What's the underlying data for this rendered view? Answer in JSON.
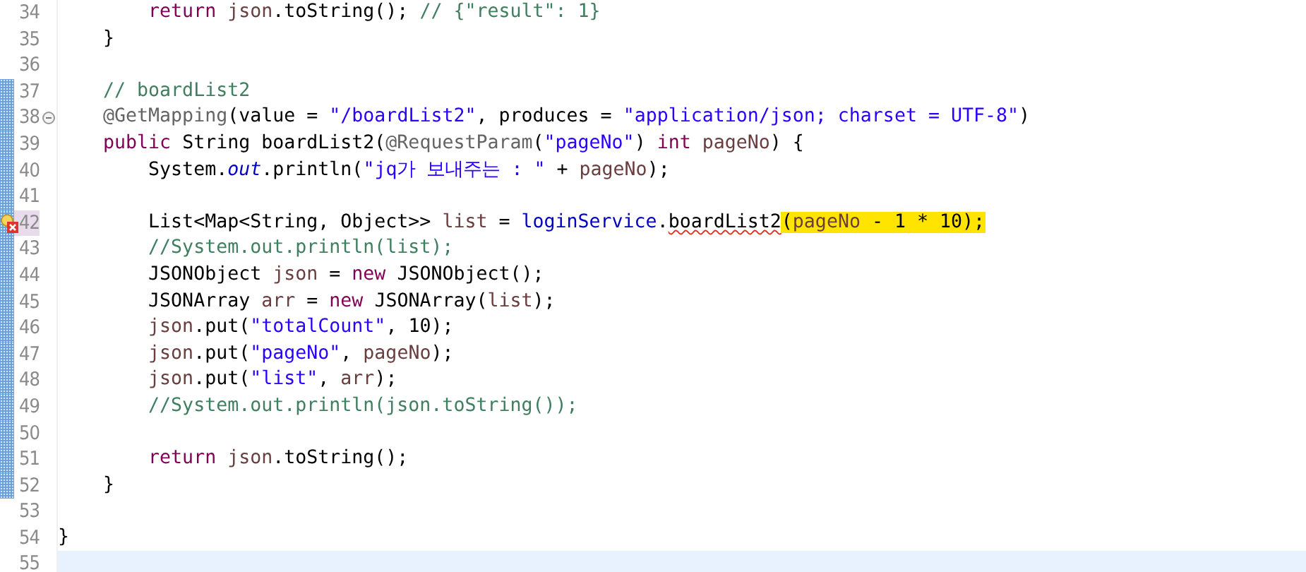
{
  "editor": {
    "lines": [
      {
        "number": "34",
        "changed": false,
        "fold": false,
        "error": false,
        "current": false,
        "tokens": [
          {
            "kind": "keyword",
            "text": "        return "
          },
          {
            "kind": "local",
            "text": "json"
          },
          {
            "kind": "plain",
            "text": ".toString(); "
          },
          {
            "kind": "comment",
            "text": "// {\"result\": 1}"
          }
        ]
      },
      {
        "number": "35",
        "changed": false,
        "fold": false,
        "error": false,
        "current": false,
        "tokens": [
          {
            "kind": "plain",
            "text": "    }"
          }
        ]
      },
      {
        "number": "36",
        "changed": false,
        "fold": false,
        "error": false,
        "current": false
      },
      {
        "number": "37",
        "changed": true,
        "fold": false,
        "error": false,
        "current": false,
        "tokens": [
          {
            "kind": "comment",
            "text": "    // boardList2"
          }
        ]
      },
      {
        "number": "38",
        "changed": true,
        "fold": true,
        "error": false,
        "current": false,
        "tokens": [
          {
            "kind": "annotation",
            "text": "    @GetMapping"
          },
          {
            "kind": "plain",
            "text": "(value = "
          },
          {
            "kind": "string",
            "text": "\"/boardList2\""
          },
          {
            "kind": "plain",
            "text": ", produces = "
          },
          {
            "kind": "string",
            "text": "\"application/json; charset = UTF-8\""
          },
          {
            "kind": "plain",
            "text": ")"
          }
        ]
      },
      {
        "number": "39",
        "changed": true,
        "fold": false,
        "error": false,
        "current": false,
        "tokens": [
          {
            "kind": "keyword",
            "text": "    public"
          },
          {
            "kind": "plain",
            "text": " String boardList2("
          },
          {
            "kind": "annotation",
            "text": "@RequestParam"
          },
          {
            "kind": "plain",
            "text": "("
          },
          {
            "kind": "string",
            "text": "\"pageNo\""
          },
          {
            "kind": "plain",
            "text": ") "
          },
          {
            "kind": "keyword",
            "text": "int "
          },
          {
            "kind": "local",
            "text": "pageNo"
          },
          {
            "kind": "plain",
            "text": ") {"
          }
        ]
      },
      {
        "number": "40",
        "changed": true,
        "fold": false,
        "error": false,
        "current": false,
        "tokens": [
          {
            "kind": "plain",
            "text": "        System."
          },
          {
            "kind": "static",
            "text": "out"
          },
          {
            "kind": "plain",
            "text": ".println("
          },
          {
            "kind": "string",
            "text": "\"jq가 보내주는 : \""
          },
          {
            "kind": "plain",
            "text": " + "
          },
          {
            "kind": "local",
            "text": "pageNo"
          },
          {
            "kind": "plain",
            "text": ");"
          }
        ]
      },
      {
        "number": "41",
        "changed": true,
        "fold": false,
        "error": false,
        "current": false
      },
      {
        "number": "42",
        "changed": true,
        "fold": false,
        "error": true,
        "current": false,
        "tokens": [
          {
            "kind": "plain",
            "text": "        List<Map<String, Object>> "
          },
          {
            "kind": "local",
            "text": "list"
          },
          {
            "kind": "plain",
            "text": " = "
          },
          {
            "kind": "field",
            "text": "loginService"
          },
          {
            "kind": "plain",
            "text": "."
          },
          {
            "kind": "squiggle",
            "text": "boardList2"
          }
        ],
        "marked_tokens": [
          {
            "kind": "plain",
            "text": "("
          },
          {
            "kind": "local",
            "text": "pageNo"
          },
          {
            "kind": "plain",
            "text": " - 1 * 10);"
          }
        ]
      },
      {
        "number": "43",
        "changed": true,
        "fold": false,
        "error": false,
        "current": false,
        "tokens": [
          {
            "kind": "comment",
            "text": "        //System.out.println(list);"
          }
        ]
      },
      {
        "number": "44",
        "changed": true,
        "fold": false,
        "error": false,
        "current": false,
        "tokens": [
          {
            "kind": "plain",
            "text": "        JSONObject "
          },
          {
            "kind": "local",
            "text": "json"
          },
          {
            "kind": "plain",
            "text": " = "
          },
          {
            "kind": "keyword",
            "text": "new"
          },
          {
            "kind": "plain",
            "text": " JSONObject();"
          }
        ]
      },
      {
        "number": "45",
        "changed": true,
        "fold": false,
        "error": false,
        "current": false,
        "tokens": [
          {
            "kind": "plain",
            "text": "        JSONArray "
          },
          {
            "kind": "local",
            "text": "arr"
          },
          {
            "kind": "plain",
            "text": " = "
          },
          {
            "kind": "keyword",
            "text": "new"
          },
          {
            "kind": "plain",
            "text": " JSONArray("
          },
          {
            "kind": "local",
            "text": "list"
          },
          {
            "kind": "plain",
            "text": ");"
          }
        ]
      },
      {
        "number": "46",
        "changed": true,
        "fold": false,
        "error": false,
        "current": false,
        "tokens": [
          {
            "kind": "local",
            "text": "        json"
          },
          {
            "kind": "plain",
            "text": ".put("
          },
          {
            "kind": "string",
            "text": "\"totalCount\""
          },
          {
            "kind": "plain",
            "text": ", 10);"
          }
        ]
      },
      {
        "number": "47",
        "changed": true,
        "fold": false,
        "error": false,
        "current": false,
        "tokens": [
          {
            "kind": "local",
            "text": "        json"
          },
          {
            "kind": "plain",
            "text": ".put("
          },
          {
            "kind": "string",
            "text": "\"pageNo\""
          },
          {
            "kind": "plain",
            "text": ", "
          },
          {
            "kind": "local",
            "text": "pageNo"
          },
          {
            "kind": "plain",
            "text": ");"
          }
        ]
      },
      {
        "number": "48",
        "changed": true,
        "fold": false,
        "error": false,
        "current": false,
        "tokens": [
          {
            "kind": "local",
            "text": "        json"
          },
          {
            "kind": "plain",
            "text": ".put("
          },
          {
            "kind": "string",
            "text": "\"list\""
          },
          {
            "kind": "plain",
            "text": ", "
          },
          {
            "kind": "local",
            "text": "arr"
          },
          {
            "kind": "plain",
            "text": ");"
          }
        ]
      },
      {
        "number": "49",
        "changed": true,
        "fold": false,
        "error": false,
        "current": false,
        "tokens": [
          {
            "kind": "comment",
            "text": "        //System.out.println(json.toString());"
          }
        ]
      },
      {
        "number": "50",
        "changed": true,
        "fold": false,
        "error": false,
        "current": false
      },
      {
        "number": "51",
        "changed": true,
        "fold": false,
        "error": false,
        "current": false,
        "tokens": [
          {
            "kind": "keyword",
            "text": "        return "
          },
          {
            "kind": "local",
            "text": "json"
          },
          {
            "kind": "plain",
            "text": ".toString();"
          }
        ]
      },
      {
        "number": "52",
        "changed": true,
        "fold": false,
        "error": false,
        "current": false,
        "tokens": [
          {
            "kind": "plain",
            "text": "    }"
          }
        ]
      },
      {
        "number": "53",
        "changed": false,
        "fold": false,
        "error": false,
        "current": false
      },
      {
        "number": "54",
        "changed": false,
        "fold": false,
        "error": false,
        "current": false,
        "tokens": [
          {
            "kind": "plain",
            "text": "}"
          }
        ]
      },
      {
        "number": "55",
        "changed": false,
        "fold": false,
        "error": false,
        "current": true
      }
    ]
  }
}
